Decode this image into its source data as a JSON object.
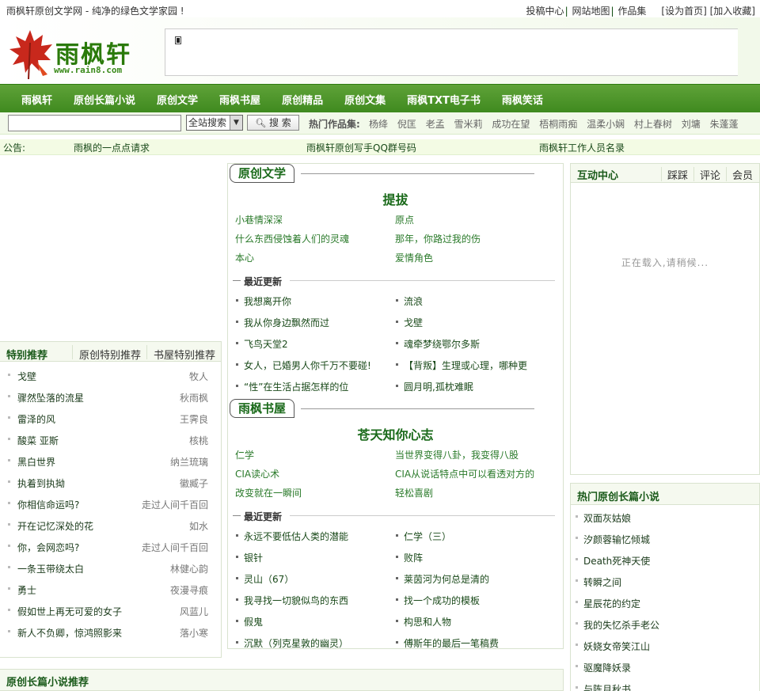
{
  "topbar": {
    "slogan": "雨枫轩原创文学网 - 纯净的绿色文学家园 !",
    "links": [
      "投稿中心",
      "网站地图",
      "作品集",
      "[设为首页]",
      "[加入收藏]"
    ]
  },
  "logo": {
    "text": "雨枫轩",
    "url": "www.rain8.com"
  },
  "nav": [
    "雨枫轩",
    "原创长篇小说",
    "原创文学",
    "雨枫书屋",
    "原创精品",
    "原创文集",
    "雨枫TXT电子书",
    "雨枫笑话"
  ],
  "search": {
    "input_value": "",
    "select_value": "全站搜索",
    "button": "搜 索",
    "hot_label": "热门作品集:",
    "hot": [
      "杨绛",
      "倪匡",
      "老孟",
      "雪米莉",
      "成功在望",
      "梧桐雨痴",
      "温柔小娴",
      "村上春树",
      "刘墉",
      "朱蓬蓬"
    ]
  },
  "notice": {
    "label": "公告:",
    "items": [
      "雨枫的一点点请求",
      "雨枫轩原创写手QQ群号码",
      "雨枫轩工作人员名录"
    ]
  },
  "left": {
    "tabs": [
      "特别推荐",
      "原创特别推荐",
      "书屋特别推荐"
    ],
    "items": [
      {
        "title": "戈壁",
        "author": "牧人"
      },
      {
        "title": "骤然坠落的流星",
        "author": "秋雨枫"
      },
      {
        "title": "雷泽的风",
        "author": "王霁良"
      },
      {
        "title": "酸菜 亚斯",
        "author": "核桃"
      },
      {
        "title": "黑白世界",
        "author": "纳兰琉璃"
      },
      {
        "title": "执着到执拗",
        "author": "徽臧子"
      },
      {
        "title": "你相信命运吗?",
        "author": "走过人间千百回"
      },
      {
        "title": "开在记忆深处的花",
        "author": "如水"
      },
      {
        "title": "你，会网恋吗?",
        "author": "走过人间千百回"
      },
      {
        "title": "一条玉带绕太白",
        "author": "林健心韵"
      },
      {
        "title": "勇士",
        "author": "夜漫寻痕"
      },
      {
        "title": "假如世上再无可爱的女子",
        "author": "风蓝儿"
      },
      {
        "title": "新人不负卿，惊鸿照影来",
        "author": "落小寒"
      }
    ],
    "bottom_title": "原创长篇小说推荐"
  },
  "mid": {
    "s1": {
      "title": "原创文学",
      "feature": "提拔",
      "links": [
        "小巷情深深",
        "原点",
        "什么东西侵蚀着人们的灵魂",
        "那年，你路过我的伤",
        "本心",
        "爱情角色"
      ],
      "recent_label": "最近更新",
      "recent": [
        "我想离开你",
        "流浪",
        "我从你身边飘然而过",
        "戈壁",
        "飞鸟天堂2",
        "魂牵梦绕鄂尔多斯",
        "女人，已婚男人你千万不要碰!",
        "【背叛】生理或心理，哪种更",
        "“性”在生活占据怎样的位",
        "圆月明,孤枕难眠"
      ]
    },
    "s2": {
      "title": "雨枫书屋",
      "feature": "苍天知你心志",
      "links": [
        "仁学",
        "当世界变得八卦，我变得八股",
        "CIA读心术",
        "CIA从说话特点中可以看透对方的",
        "改变就在一瞬间",
        "轻松喜剧"
      ],
      "recent_label": "最近更新",
      "recent": [
        "永远不要低估人类的潜能",
        "仁学（三）",
        "银针",
        "败阵",
        "灵山（67）",
        "莱茵河为何总是清的",
        "我寻找一切貌似鸟的东西",
        "找一个成功的模板",
        "假鬼",
        "构思和人物",
        "沉默（列克星敦的幽灵）",
        "傅斯年的最后一笔稿费"
      ]
    }
  },
  "right1": {
    "tabs": [
      "互动中心",
      "踩踩",
      "评论",
      "会员"
    ],
    "loading": "正在载入,请稍候..."
  },
  "right2": {
    "title": "热门原创长篇小说",
    "items": [
      "双面灰姑娘",
      "汐颜蓉输忆倾城",
      "Death死神天使",
      "转瞬之间",
      "星辰花的约定",
      "我的失忆杀手老公",
      "妖娆女帝笑江山",
      "驱魔降妖录",
      "与陈月秋书"
    ]
  }
}
